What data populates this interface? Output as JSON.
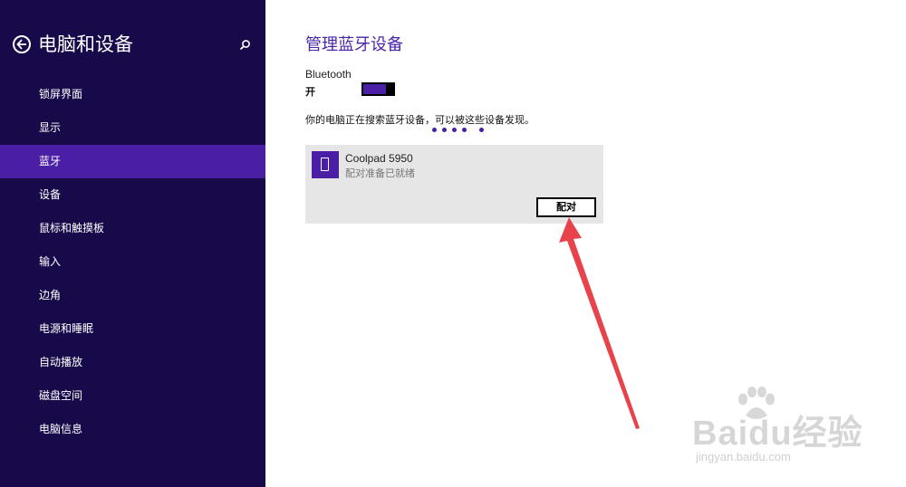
{
  "sidebar": {
    "title": "电脑和设备",
    "items": [
      {
        "label": "锁屏界面"
      },
      {
        "label": "显示"
      },
      {
        "label": "蓝牙",
        "active": true
      },
      {
        "label": "设备"
      },
      {
        "label": "鼠标和触摸板"
      },
      {
        "label": "输入"
      },
      {
        "label": "边角"
      },
      {
        "label": "电源和睡眠"
      },
      {
        "label": "自动播放"
      },
      {
        "label": "磁盘空间"
      },
      {
        "label": "电脑信息"
      }
    ]
  },
  "main": {
    "title": "管理蓝牙设备",
    "bluetooth_label": "Bluetooth",
    "bluetooth_state": "开",
    "bluetooth_on": true,
    "search_text": "你的电脑正在搜索蓝牙设备，可以被这些设备发现。",
    "device": {
      "name": "Coolpad 5950",
      "status": "配对准备已就绪",
      "icon": "phone-icon",
      "pair_label": "配对"
    }
  },
  "watermark": {
    "brand": "Baidu经验",
    "url": "jingyan.baidu.com"
  },
  "colors": {
    "sidebar_bg": "#180a4a",
    "accent": "#4a1fa6",
    "title": "#4a26a6",
    "card_bg": "#e6e6e6",
    "annotation_arrow": "#e8424a"
  }
}
